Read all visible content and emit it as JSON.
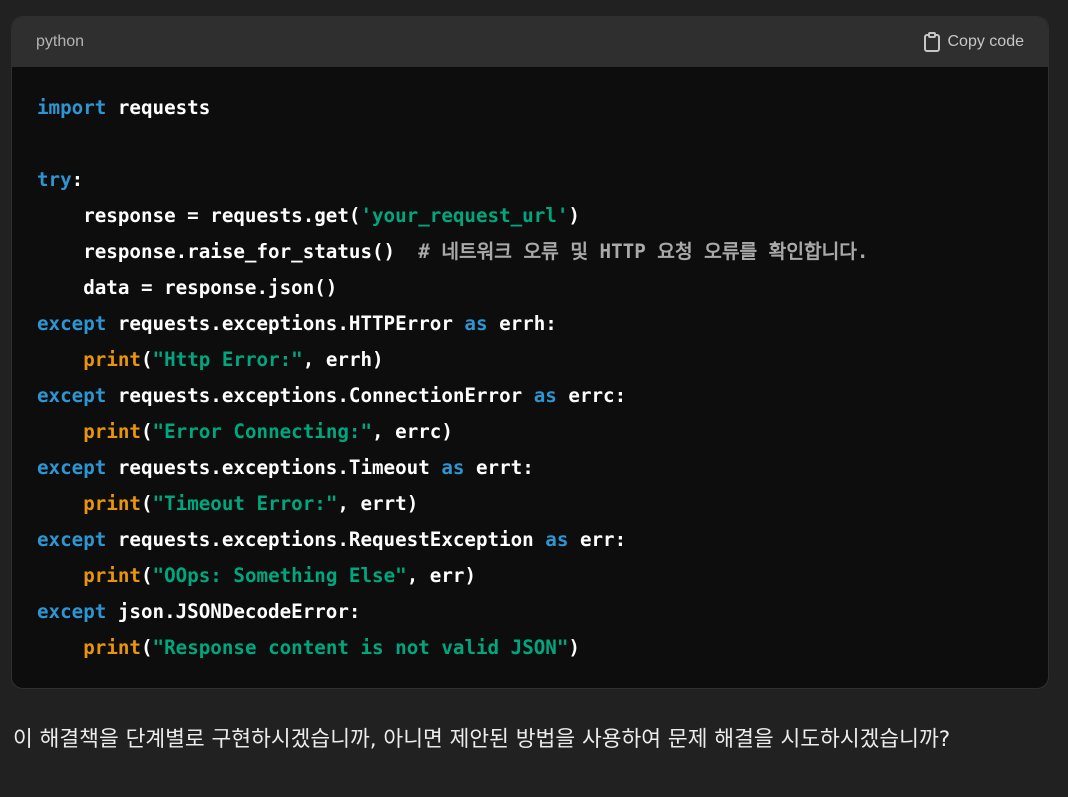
{
  "code_block": {
    "language": "python",
    "copy_label": "Copy code",
    "copy_icon": "clipboard-icon",
    "lines": [
      [
        {
          "t": "kw",
          "v": "import"
        },
        {
          "t": "txt",
          "v": " requests"
        }
      ],
      [],
      [
        {
          "t": "kw",
          "v": "try"
        },
        {
          "t": "txt",
          "v": ":"
        }
      ],
      [
        {
          "t": "txt",
          "v": "    response = requests.get("
        },
        {
          "t": "str",
          "v": "'your_request_url'"
        },
        {
          "t": "txt",
          "v": ")"
        }
      ],
      [
        {
          "t": "txt",
          "v": "    response.raise_for_status()  "
        },
        {
          "t": "cm",
          "v": "# 네트워크 오류 및 HTTP 요청 오류를 확인합니다."
        }
      ],
      [
        {
          "t": "txt",
          "v": "    data = response.json()"
        }
      ],
      [
        {
          "t": "kw",
          "v": "except"
        },
        {
          "t": "txt",
          "v": " requests.exceptions.HTTPError "
        },
        {
          "t": "kw",
          "v": "as"
        },
        {
          "t": "txt",
          "v": " errh:"
        }
      ],
      [
        {
          "t": "txt",
          "v": "    "
        },
        {
          "t": "bi",
          "v": "print"
        },
        {
          "t": "txt",
          "v": "("
        },
        {
          "t": "str",
          "v": "\"Http Error:\""
        },
        {
          "t": "txt",
          "v": ", errh)"
        }
      ],
      [
        {
          "t": "kw",
          "v": "except"
        },
        {
          "t": "txt",
          "v": " requests.exceptions.ConnectionError "
        },
        {
          "t": "kw",
          "v": "as"
        },
        {
          "t": "txt",
          "v": " errc:"
        }
      ],
      [
        {
          "t": "txt",
          "v": "    "
        },
        {
          "t": "bi",
          "v": "print"
        },
        {
          "t": "txt",
          "v": "("
        },
        {
          "t": "str",
          "v": "\"Error Connecting:\""
        },
        {
          "t": "txt",
          "v": ", errc)"
        }
      ],
      [
        {
          "t": "kw",
          "v": "except"
        },
        {
          "t": "txt",
          "v": " requests.exceptions.Timeout "
        },
        {
          "t": "kw",
          "v": "as"
        },
        {
          "t": "txt",
          "v": " errt:"
        }
      ],
      [
        {
          "t": "txt",
          "v": "    "
        },
        {
          "t": "bi",
          "v": "print"
        },
        {
          "t": "txt",
          "v": "("
        },
        {
          "t": "str",
          "v": "\"Timeout Error:\""
        },
        {
          "t": "txt",
          "v": ", errt)"
        }
      ],
      [
        {
          "t": "kw",
          "v": "except"
        },
        {
          "t": "txt",
          "v": " requests.exceptions.RequestException "
        },
        {
          "t": "kw",
          "v": "as"
        },
        {
          "t": "txt",
          "v": " err:"
        }
      ],
      [
        {
          "t": "txt",
          "v": "    "
        },
        {
          "t": "bi",
          "v": "print"
        },
        {
          "t": "txt",
          "v": "("
        },
        {
          "t": "str",
          "v": "\"OOps: Something Else\""
        },
        {
          "t": "txt",
          "v": ", err)"
        }
      ],
      [
        {
          "t": "kw",
          "v": "except"
        },
        {
          "t": "txt",
          "v": " json.JSONDecodeError:"
        }
      ],
      [
        {
          "t": "txt",
          "v": "    "
        },
        {
          "t": "bi",
          "v": "print"
        },
        {
          "t": "txt",
          "v": "("
        },
        {
          "t": "str",
          "v": "\"Response content is not valid JSON\""
        },
        {
          "t": "txt",
          "v": ")"
        }
      ]
    ]
  },
  "message": {
    "text": "이 해결책을 단계별로 구현하시겠습니까, 아니면 제안된 방법을 사용하여 문제 해결을 시도하시겠습니까?"
  },
  "colors": {
    "page_bg": "#212121",
    "code_bg": "#0d0d0d",
    "header_bg": "#2f2f2f",
    "keyword": "#2e95d3",
    "builtin": "#e9950c",
    "string": "#00a67d",
    "comment": "#a9a9a9"
  }
}
